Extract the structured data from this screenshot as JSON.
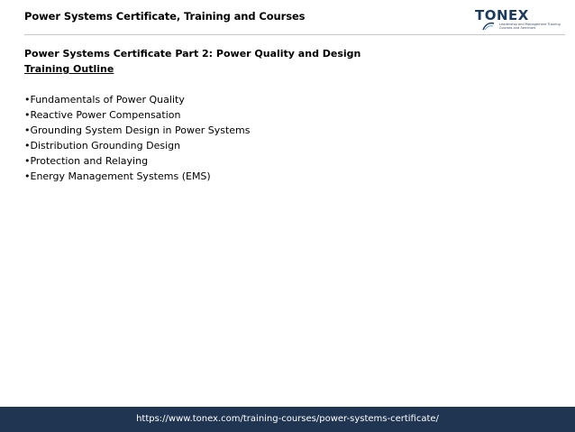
{
  "header": {
    "title": "Power Systems Certificate, Training and Courses",
    "logo": {
      "wordmark": "TONEX",
      "tagline": "Leadership and Management Training Courses and Seminars"
    }
  },
  "main": {
    "slide_title": "Power Systems Certificate Part 2: Power Quality and Design",
    "outline_heading": "Training Outline",
    "bullets": [
      "•Fundamentals of Power Quality",
      "•Reactive Power Compensation",
      "•Grounding System Design in Power Systems",
      "•Distribution Grounding Design",
      "•Protection and Relaying",
      "•Energy Management Systems (EMS)"
    ]
  },
  "footer": {
    "url": "https://www.tonex.com/training-courses/power-systems-certificate/",
    "background_color": "#1f3552"
  }
}
